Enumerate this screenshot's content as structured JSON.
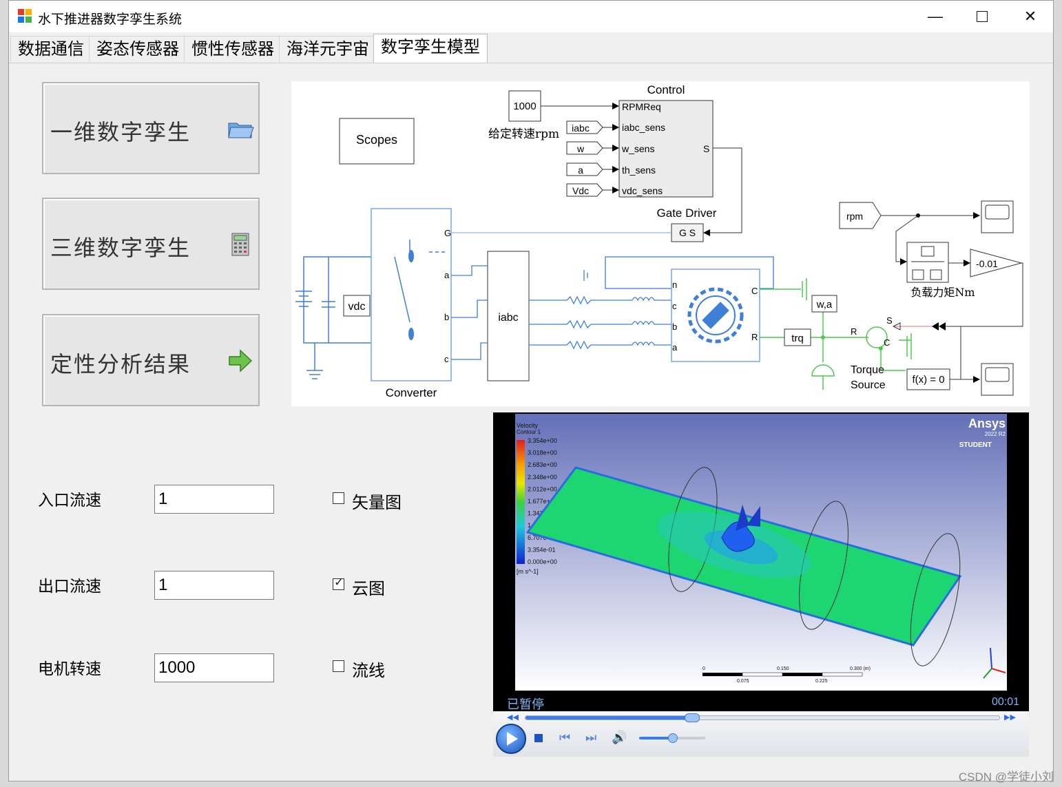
{
  "window": {
    "title": "水下推进器数字孪生系统"
  },
  "tabs": [
    {
      "label": "数据通信"
    },
    {
      "label": "姿态传感器"
    },
    {
      "label": "惯性传感器"
    },
    {
      "label": "海洋元宇宙"
    },
    {
      "label": "数字孪生模型",
      "active": true
    }
  ],
  "buttons": {
    "one_d": {
      "label": "一维数字孪生",
      "icon": "folder-icon"
    },
    "three_d": {
      "label": "三维数字孪生",
      "icon": "calculator-icon"
    },
    "analysis": {
      "label": "定性分析结果",
      "icon": "green-arrow-icon"
    }
  },
  "diagram": {
    "control_block": "Control",
    "rpm_const": "1000",
    "rpm_label": "给定转速rpm",
    "scopes": "Scopes",
    "inputs": [
      "iabc",
      "w",
      "a",
      "Vdc"
    ],
    "ports": [
      "RPMReq",
      "iabc_sens",
      "w_sens",
      "th_sens",
      "vdc_sens"
    ],
    "port_s": "S",
    "gate_driver": "Gate Driver",
    "gate_ports": "G  S",
    "vdc": "vdc",
    "converter": "Converter",
    "converter_ports": [
      "G",
      "a",
      "b",
      "c"
    ],
    "iabc": "iabc",
    "motor_ports": [
      "n",
      "c",
      "b",
      "a"
    ],
    "motor_cr": [
      "C",
      "R"
    ],
    "wa": "w,a",
    "trq": "trq",
    "rpm": "rpm",
    "gain": "-0.01",
    "load_label": "负载力矩Nm",
    "torque_source": "Torque\nSource",
    "fx": "f(x) = 0",
    "torque_ports": [
      "R",
      "S",
      "C"
    ]
  },
  "fields": {
    "inlet": {
      "label": "入口流速",
      "value": "1"
    },
    "outlet": {
      "label": "出口流速",
      "value": "1"
    },
    "motor_speed": {
      "label": "电机转速",
      "value": "1000"
    }
  },
  "checkboxes": {
    "vector": {
      "label": "矢量图",
      "checked": false
    },
    "contour": {
      "label": "云图",
      "checked": true
    },
    "streamline": {
      "label": "流线",
      "checked": false
    }
  },
  "player": {
    "status": "已暂停",
    "time": "00:01",
    "progress": 0.35,
    "volume": 0.5,
    "legend_title": "Velocity",
    "legend_subtitle": "Contour 1",
    "legend_values": [
      "3.354e+00",
      "3.018e+00",
      "2.683e+00",
      "2.348e+00",
      "2.012e+00",
      "1.677e+00",
      "1.341e+00",
      "1.006e+00",
      "6.707e-01",
      "3.354e-01",
      "0.000e+00"
    ],
    "legend_unit": "[m s^-1]",
    "brand": "Ansys",
    "brand_version": "2022 R2",
    "brand_edition": "STUDENT",
    "scale_top": [
      "0",
      "0.150",
      "0.300 (m)"
    ],
    "scale_bottom": [
      "0.075",
      "0.225"
    ]
  },
  "watermark": "CSDN @学徒小刘"
}
